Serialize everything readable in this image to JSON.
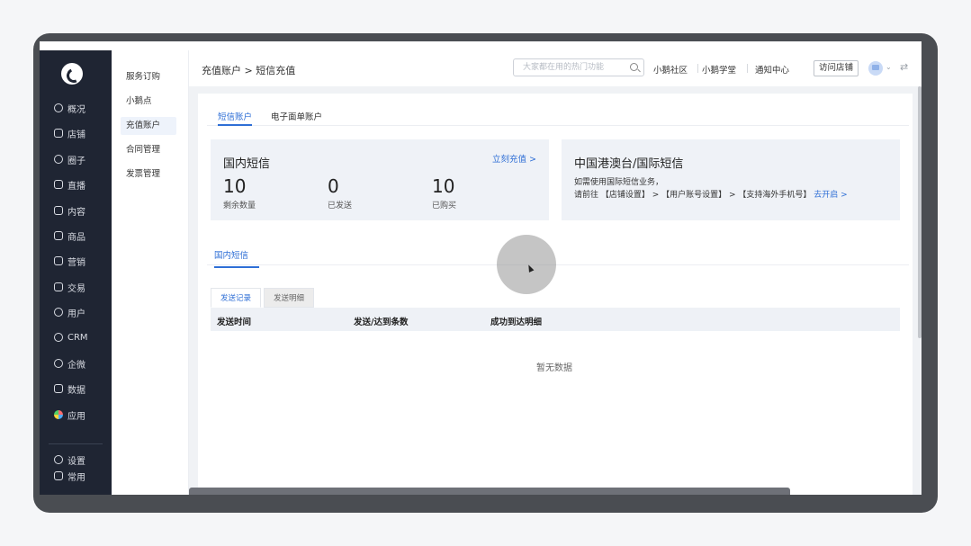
{
  "nav": {
    "items": [
      {
        "label": "概况",
        "icon": "dashboard-icon"
      },
      {
        "label": "店铺",
        "icon": "store-icon"
      },
      {
        "label": "圈子",
        "icon": "circle-icon"
      },
      {
        "label": "直播",
        "icon": "live-icon"
      },
      {
        "label": "内容",
        "icon": "content-icon"
      },
      {
        "label": "商品",
        "icon": "goods-icon"
      },
      {
        "label": "营销",
        "icon": "marketing-icon"
      },
      {
        "label": "交易",
        "icon": "trade-icon"
      },
      {
        "label": "用户",
        "icon": "user-icon"
      },
      {
        "label": "CRM",
        "icon": "crm-icon"
      },
      {
        "label": "企微",
        "icon": "wecom-icon"
      },
      {
        "label": "数据",
        "icon": "data-icon"
      },
      {
        "label": "应用",
        "icon": "apps-icon"
      },
      {
        "label": "设置",
        "icon": "settings-icon"
      },
      {
        "label": "常用",
        "icon": "favorites-icon"
      }
    ]
  },
  "subnav": {
    "items": [
      "服务订购",
      "小鹅点",
      "充值账户",
      "合同管理",
      "发票管理"
    ],
    "active": "充值账户"
  },
  "header": {
    "breadcrumb": "充值账户 > 短信充值",
    "search_placeholder": "大家都在用的热门功能",
    "links": [
      "小鹅社区",
      "小鹅学堂",
      "通知中心"
    ],
    "visit_store": "访问店铺"
  },
  "tabs": [
    "短信账户",
    "电子面单账户"
  ],
  "domestic": {
    "title": "国内短信",
    "recharge_link": "立刻充值 >",
    "stats": [
      {
        "value": "10",
        "label": "剩余数量"
      },
      {
        "value": "0",
        "label": "已发送"
      },
      {
        "value": "10",
        "label": "已购买"
      }
    ]
  },
  "international": {
    "title": "中国港澳台/国际短信",
    "line1": "如需使用国际短信业务，",
    "line2": "请前往 【店铺设置】 > 【用户账号设置】 > 【支持海外手机号】",
    "enable_link": "去开启 >"
  },
  "section_tab": "国内短信",
  "sub_tabs": [
    "发送记录",
    "发送明细"
  ],
  "table": {
    "columns": [
      "发送时间",
      "发送/达到条数",
      "成功到达明细"
    ],
    "empty_text": "暂无数据"
  }
}
